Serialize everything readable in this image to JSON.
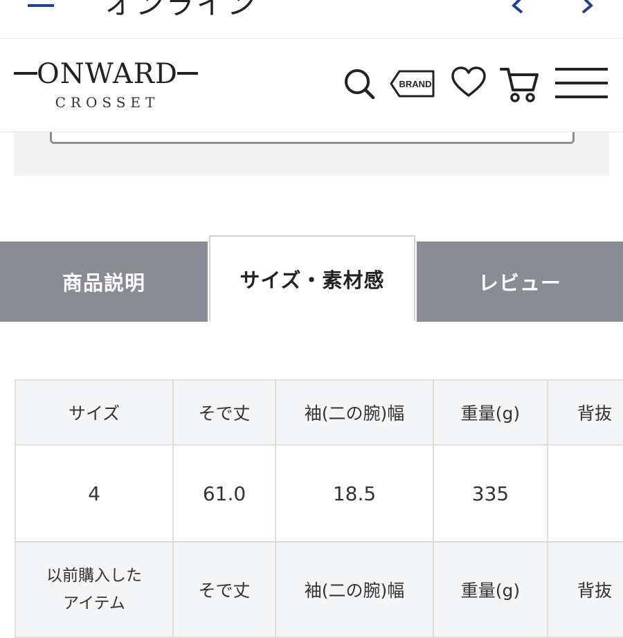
{
  "browser": {
    "title": "オンライン"
  },
  "header": {
    "logo": {
      "word": "ONWARD",
      "sub": "CROSSET"
    },
    "brand_icon_label": "BRAND",
    "icons": [
      "search-icon",
      "brand-tag-icon",
      "heart-icon",
      "cart-icon",
      "menu-icon"
    ]
  },
  "tabs": [
    {
      "label": "商品説明",
      "active": false
    },
    {
      "label": "サイズ・素材感",
      "active": true
    },
    {
      "label": "レビュー",
      "active": false
    }
  ],
  "size_table": {
    "columns": [
      "サイズ",
      "そで丈",
      "袖(二の腕)幅",
      "重量(g)",
      "背抜"
    ],
    "rows": [
      [
        "4",
        "61.0",
        "18.5",
        "335",
        ""
      ]
    ],
    "previous_purchase": {
      "label": "以前購入したアイテム",
      "label_line1": "以前購入した",
      "label_line2": "アイテム",
      "cells": [
        "そで丈",
        "袖(二の腕)幅",
        "重量(g)",
        "背抜"
      ]
    }
  },
  "colors": {
    "tab_inactive": "#8a8c94",
    "table_header_bg": "#f3f5f7",
    "nav_accent": "#1f3f8f"
  }
}
